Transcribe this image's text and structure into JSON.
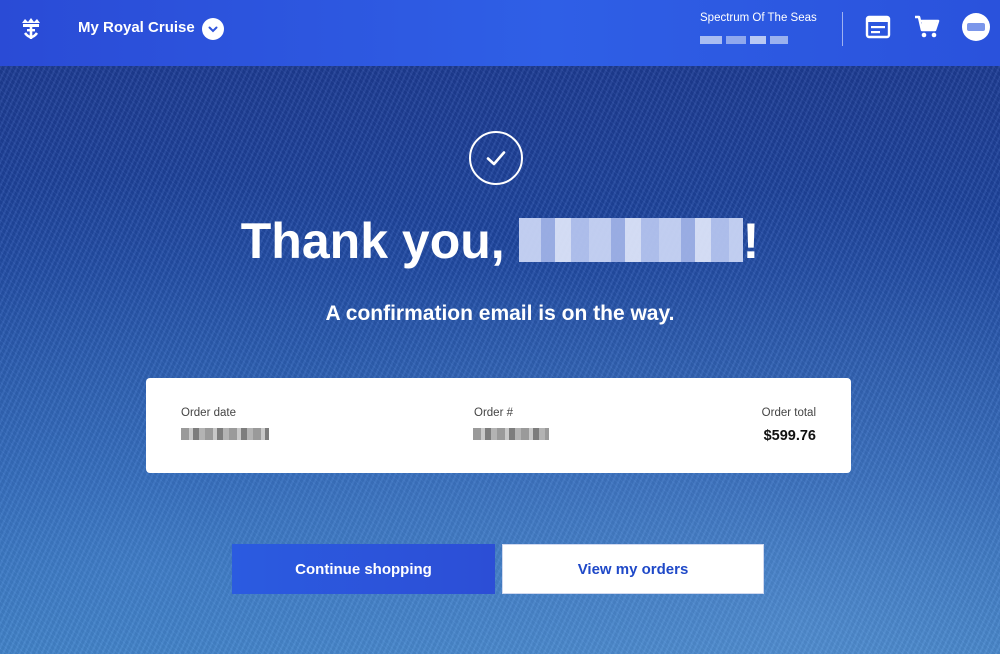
{
  "header": {
    "brand": "My Royal Cruise",
    "ship_name": "Spectrum Of The Seas"
  },
  "icons": {
    "logo": "royal-crown-anchor-icon",
    "chevron": "chevron-down-icon",
    "calendar": "calendar-icon",
    "cart": "cart-icon",
    "avatar": "avatar"
  },
  "hero": {
    "thanks_prefix": "Thank you, ",
    "thanks_suffix": "!",
    "subtitle": "A confirmation email is on the way."
  },
  "order": {
    "date_label": "Order date",
    "number_label": "Order #",
    "total_label": "Order total",
    "total_value": "$599.76"
  },
  "buttons": {
    "continue": "Continue shopping",
    "view_orders": "View my orders"
  },
  "colors": {
    "header": "#2f5fe6",
    "primary": "#2b5be0",
    "link": "#1f49c8"
  }
}
